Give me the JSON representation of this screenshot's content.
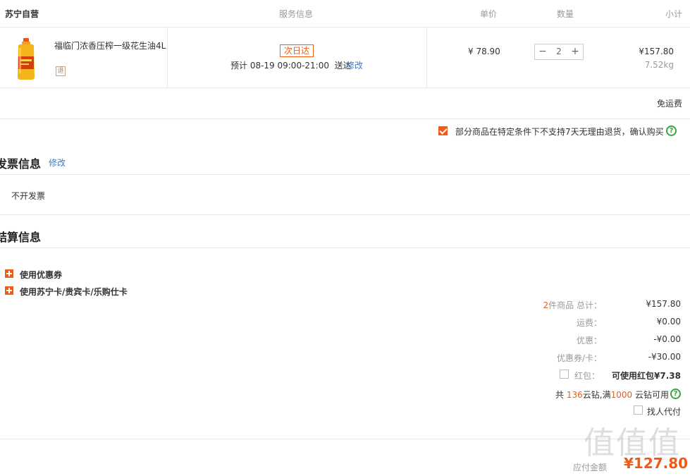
{
  "cart_header": {
    "store": "苏宁自营",
    "service": "服务信息",
    "unit_price": "单价",
    "quantity": "数量",
    "subtotal": "小计"
  },
  "product": {
    "name": "福临门浓香压榨一级花生油4L",
    "return_badge": "退",
    "delivery_badge": "次日达",
    "delivery_text": "预计 08-19 09:00-21:00  送达",
    "delivery_edit": "修改",
    "price": "¥ 78.90",
    "qty": "2",
    "qty_minus": "−",
    "qty_plus": "+",
    "subtotal": "¥157.80",
    "weight": "7.52kg"
  },
  "shipping_note": "免运费",
  "return_confirm": {
    "checked": true,
    "text": "部分商品在特定条件下不支持7天无理由退货，确认购买"
  },
  "invoice": {
    "title": "发票信息",
    "edit": "修改",
    "value": "不开发票"
  },
  "settlement": {
    "title": "结算信息",
    "use_coupon": "使用优惠券",
    "use_card": "使用苏宁卡/贵宾卡/乐购仕卡"
  },
  "summary": {
    "items_count": "2",
    "items_label": "件商品 总计：",
    "total": "¥157.80",
    "freight_label": "运费：",
    "freight": "¥0.00",
    "discount_label": "优惠：",
    "discount": "-¥0.00",
    "coupon_label": "优惠券/卡：",
    "coupon": "-¥30.00",
    "redpacket_label": "红包：",
    "redpacket_value": "可使用红包¥7.38",
    "diamond_prefix": "共",
    "diamond_count": "136",
    "diamond_mid": "云钻,满",
    "diamond_min": "1000",
    "diamond_suffix": "云钻可用",
    "proxy_pay": "找人代付",
    "payable_label": "应付金额",
    "payable": "¥127.80"
  },
  "watermark": "值值值",
  "colors": {
    "accent": "#f05a14",
    "link": "#3c7cc8",
    "help": "#3aa540"
  }
}
